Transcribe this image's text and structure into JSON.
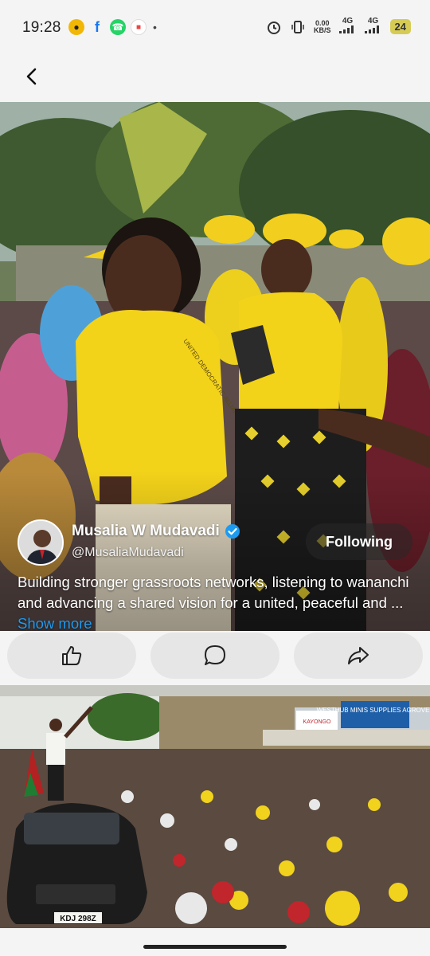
{
  "status_bar": {
    "time": "19:28",
    "net_speed_value": "0.00",
    "net_speed_unit": "KB/S",
    "network_1": "4G",
    "network_2": "4G",
    "battery": "24",
    "icons": [
      "game-icon",
      "facebook-icon",
      "whatsapp-icon",
      "app-icon",
      "alarm-icon",
      "vibrate-icon",
      "wifi-icon",
      "signal-icon"
    ]
  },
  "header": {
    "back_icon": "chevron-left-icon"
  },
  "post": {
    "author_name": "Musalia W Mudavadi",
    "author_handle": "@MusaliaMudavadi",
    "follow_label": "Following",
    "caption": "Building stronger grassroots networks, listening to wananchi and advancing a shared vision for a united, peaceful and ...",
    "show_more": "Show more",
    "shirt_text": "UNITED DEMOCRATIC ALLIANCE"
  },
  "actions": {
    "like_icon": "thumbs-up-icon",
    "comment_icon": "comment-icon",
    "share_icon": "share-icon"
  },
  "post2": {
    "sign_1": "WESTHUB MINIS SUPPLIES AGROVET",
    "sign_2": "KAYONGO",
    "plate": "KDJ 298Z"
  },
  "colors": {
    "accent": "#1d9bf0",
    "yellow_shirt": "#f3d21a",
    "background": "#f4f4f4"
  }
}
